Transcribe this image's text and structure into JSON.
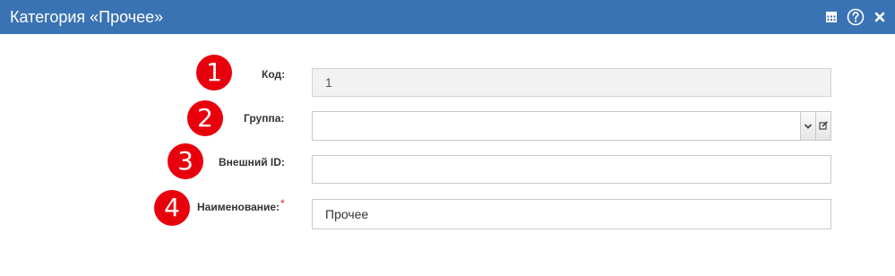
{
  "window": {
    "title": "Категория «Прочее»",
    "accent": "#3a73b3",
    "toolbar_icons": [
      "calendar-icon",
      "help-icon",
      "close-icon"
    ]
  },
  "form": {
    "fields": [
      {
        "badge": "1",
        "label": "Код:",
        "value": "1",
        "readonly": true
      },
      {
        "badge": "2",
        "label": "Группа:",
        "value": "",
        "type": "select"
      },
      {
        "badge": "3",
        "label": "Внешний ID:",
        "value": ""
      },
      {
        "badge": "4",
        "label": "Наименование:",
        "required_mark": "*",
        "value": "Прочее"
      }
    ]
  },
  "colors": {
    "badge": "#e8000c",
    "required": "#e02020"
  }
}
